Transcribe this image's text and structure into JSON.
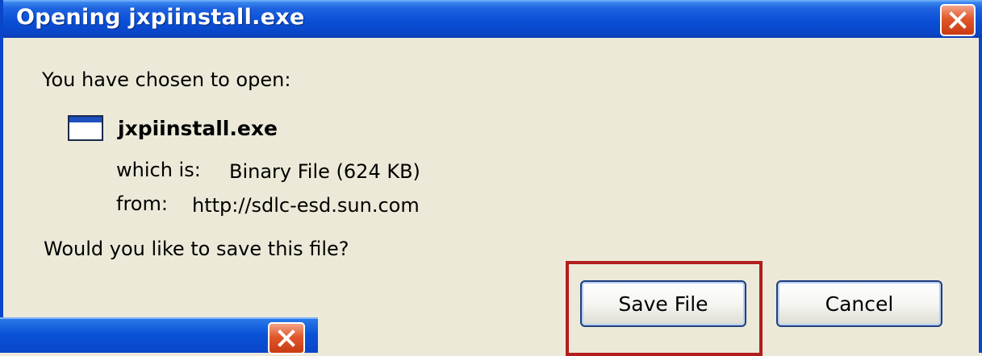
{
  "dialog": {
    "title": "Opening jxpiinstall.exe",
    "intro": "You have chosen to open:",
    "file": {
      "icon": "application-window-icon",
      "name": "jxpiinstall.exe",
      "type_label": "which is:",
      "type_value": "Binary File (624 KB)",
      "from_label": "from:",
      "from_value": "http://sdlc-esd.sun.com"
    },
    "question": "Would you like to save this file?",
    "buttons": {
      "save": "Save File",
      "cancel": "Cancel"
    }
  },
  "colors": {
    "titlebar": "#0a46c9",
    "close_button": "#e0572a",
    "highlight": "#b21d1d",
    "face": "#ece9d8"
  }
}
